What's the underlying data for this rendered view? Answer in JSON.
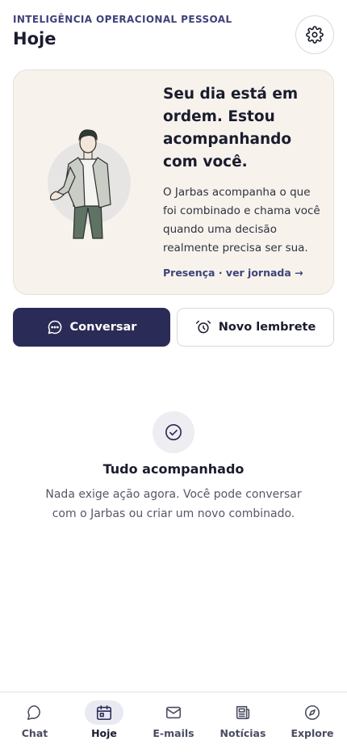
{
  "header": {
    "eyebrow": "INTELIGÊNCIA OPERACIONAL PESSOAL",
    "title": "Hoje"
  },
  "hero": {
    "heading": "Seu dia está em ordem. Estou acompanhando com você.",
    "body": "O Jarbas acompanha o que foi combinado e chama você quando uma decisão realmente precisa ser sua.",
    "link": "Presença · ver jornada →"
  },
  "actions": {
    "primary_label": "Conversar",
    "secondary_label": "Novo lembrete"
  },
  "empty_state": {
    "title": "Tudo acompanhado",
    "text": "Nada exige ação agora. Você pode conversar com o Jarbas ou criar um novo combinado."
  },
  "tabs": [
    {
      "label": "Chat",
      "icon": "chat-icon",
      "active": false
    },
    {
      "label": "Hoje",
      "icon": "calendar-icon",
      "active": true
    },
    {
      "label": "E-mails",
      "icon": "mail-icon",
      "active": false
    },
    {
      "label": "Notícias",
      "icon": "news-icon",
      "active": false
    },
    {
      "label": "Explore",
      "icon": "compass-icon",
      "active": false
    }
  ],
  "colors": {
    "accent": "#2b2b57",
    "hero_bg": "#f7f3ec",
    "eyebrow": "#3e4379"
  }
}
